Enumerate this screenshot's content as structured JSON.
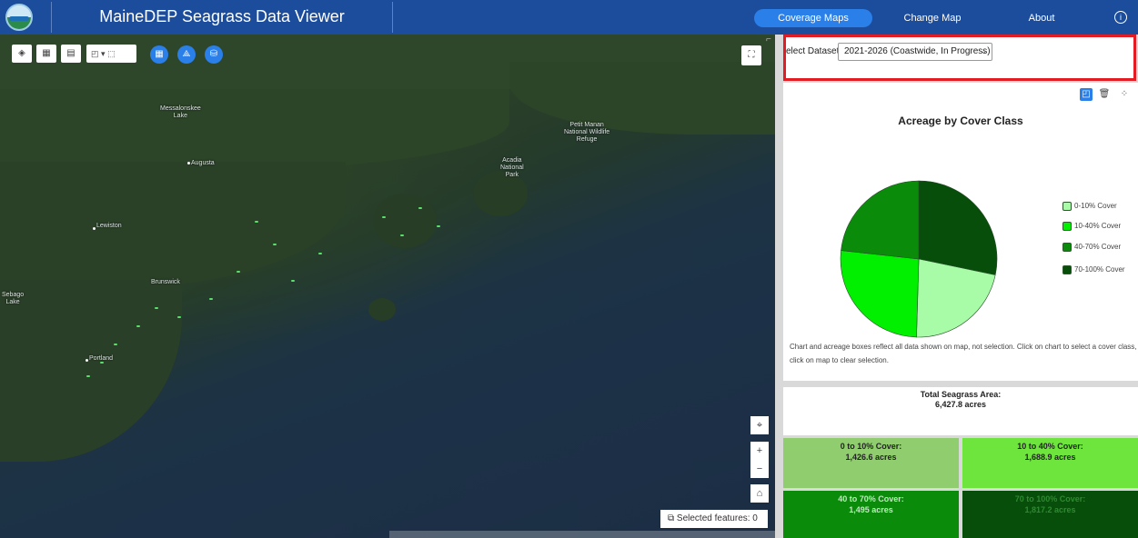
{
  "header": {
    "title": "MaineDEP Seagrass Data Viewer",
    "nav": [
      {
        "label": "Coverage Maps",
        "active": true
      },
      {
        "label": "Change Map",
        "active": false
      },
      {
        "label": "About",
        "active": false
      }
    ],
    "info_icon": "info-icon"
  },
  "map": {
    "labels": {
      "messalonskee": "Messalonskee\nLake",
      "augusta": "Augusta",
      "petit_manan": "Petit Manan\nNational Wildlife\nRefuge",
      "acadia": "Acadia\nNational\nPark",
      "lewiston": "Lewiston",
      "brunswick": "Brunswick",
      "sebago": "Sebago\nLake",
      "portland": "Portland"
    },
    "toolbar_icons": [
      "layers-icon",
      "basemap-gallery-icon",
      "print-icon",
      "select-icon",
      "clear-selection-icon",
      "table-icon",
      "share-icon",
      "database-icon"
    ],
    "selected_features": "Selected features: 0",
    "controls": [
      "locate-icon",
      "zoom-in-icon",
      "zoom-out-icon",
      "home-icon"
    ]
  },
  "panel": {
    "dataset_label": "elect Dataset",
    "dataset_value": "2021-2026 (Coastwide, In Progress)",
    "chart_note": "Chart and acreage boxes reflect all data shown on map, not selection. Click on chart to select a cover class, click on map to clear selection.",
    "total_label": "Total Seagrass Area:",
    "total_value": "6,427.8 acres",
    "classes": [
      {
        "label": "0 to 10% Cover:",
        "value": "1,426.6 acres",
        "bg": "#8fcd6e",
        "color": "#222"
      },
      {
        "label": "10 to 40% Cover:",
        "value": "1,688.9 acres",
        "bg": "#6ee53c",
        "color": "#222"
      },
      {
        "label": "40 to 70% Cover:",
        "value": "1,495 acres",
        "bg": "#0a8c0a",
        "color": "#bfe8bf"
      },
      {
        "label": "70 to 100% Cover:",
        "value": "1,817.2 acres",
        "bg": "#064e09",
        "color": "#2f8a32"
      }
    ]
  },
  "chart_data": {
    "type": "pie",
    "title": "Acreage by Cover Class",
    "categories": [
      "0-10% Cover",
      "10-40% Cover",
      "40-70% Cover",
      "70-100% Cover"
    ],
    "values": [
      1426.6,
      1688.9,
      1495,
      1817.2
    ],
    "colors": [
      "#a8fca8",
      "#00f000",
      "#0a8c0a",
      "#064e09"
    ],
    "legend_position": "right"
  }
}
